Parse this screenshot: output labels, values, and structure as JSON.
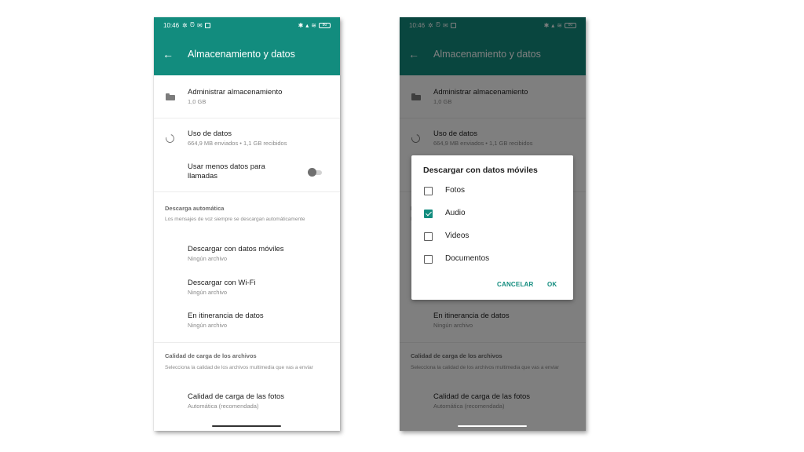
{
  "colors": {
    "accent": "#128c7e",
    "overlay": "rgba(0,0,0,0.5)",
    "checkbox_checked": "#128c7e"
  },
  "status_bar": {
    "time": "10:46",
    "left_icons": [
      "settings-icon",
      "alarm-icon",
      "mail-icon",
      "square-app-icon"
    ],
    "right_icons": [
      "bluetooth-icon",
      "signal-icon",
      "wifi-icon"
    ],
    "battery": "80"
  },
  "app_bar": {
    "back_icon": "back-arrow-icon",
    "title": "Almacenamiento y datos"
  },
  "settings": {
    "manage_storage": {
      "icon": "folder-icon",
      "title": "Administrar almacenamiento",
      "subtitle": "1,0 GB"
    },
    "data_usage": {
      "icon": "data-usage-icon",
      "title": "Uso de datos",
      "subtitle": "664,9 MB enviados • 1,1 GB recibidos"
    },
    "less_data_calls": {
      "title_line1": "Usar menos datos para",
      "title_line2": "llamadas",
      "toggle_on": false
    },
    "auto_download": {
      "header": "Descarga automática",
      "description": "Los mensajes de voz siempre se descargan automáticamente",
      "items": [
        {
          "title": "Descargar con datos móviles",
          "subtitle": "Ningún archivo"
        },
        {
          "title": "Descargar con Wi-Fi",
          "subtitle": "Ningún archivo"
        },
        {
          "title": "En itinerancia de datos",
          "subtitle": "Ningún archivo"
        }
      ]
    },
    "upload_quality": {
      "header": "Calidad de carga de los archivos",
      "description": "Selecciona la calidad de los archivos multimedia que vas a enviar",
      "items": [
        {
          "title": "Calidad de carga de las fotos",
          "subtitle": "Automática (recomendada)"
        }
      ]
    }
  },
  "dialog": {
    "title": "Descargar con datos móviles",
    "options": [
      {
        "label": "Fotos",
        "checked": false
      },
      {
        "label": "Audio",
        "checked": true
      },
      {
        "label": "Videos",
        "checked": false
      },
      {
        "label": "Documentos",
        "checked": false
      }
    ],
    "cancel_label": "CANCELAR",
    "ok_label": "OK"
  }
}
